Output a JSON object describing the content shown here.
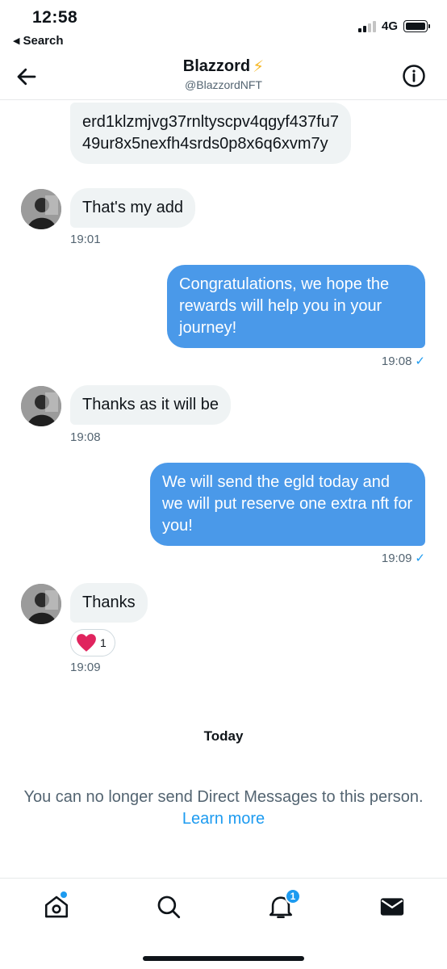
{
  "status_bar": {
    "time": "12:58",
    "back_app_label": "Search",
    "network": "4G"
  },
  "header": {
    "name": "Blazzord",
    "name_emoji": "⚡",
    "handle": "@BlazzordNFT",
    "back_icon": "back-arrow-icon",
    "info_icon": "info-icon"
  },
  "messages": [
    {
      "direction": "incoming",
      "text": "erd1klzmjvg37rnltyscpv4qgyf437fu749ur8x5nexfh4srds0p8x6q6xvm7y"
    },
    {
      "direction": "incoming",
      "text": "That's my add",
      "time": "19:01"
    },
    {
      "direction": "outgoing",
      "text": "Congratulations, we hope the rewards will help you in your journey!",
      "time": "19:08"
    },
    {
      "direction": "incoming",
      "text": "Thanks as it will be",
      "time": "19:08"
    },
    {
      "direction": "outgoing",
      "text": "We will send the egld today and we will put reserve one extra nft for you!",
      "time": "19:09"
    },
    {
      "direction": "incoming",
      "text": "Thanks",
      "time": "19:09",
      "reaction": {
        "icon": "heart-icon",
        "count": "1"
      }
    }
  ],
  "read_check": "✓",
  "day_separator": "Today",
  "notice": {
    "text": "You can no longer send Direct Messages to this person.",
    "link": "Learn more"
  },
  "tab_bar": {
    "items": [
      {
        "icon": "home-icon",
        "has_dot": true
      },
      {
        "icon": "search-icon"
      },
      {
        "icon": "bell-icon",
        "badge": "1"
      },
      {
        "icon": "mail-icon",
        "active": true
      }
    ]
  },
  "colors": {
    "accent": "#1d9bf0",
    "outgoing_bubble": "#4a99e9",
    "incoming_bubble": "#eff3f4",
    "secondary_text": "#536471",
    "heart": "#e0245e",
    "bolt": "#f7b928"
  }
}
